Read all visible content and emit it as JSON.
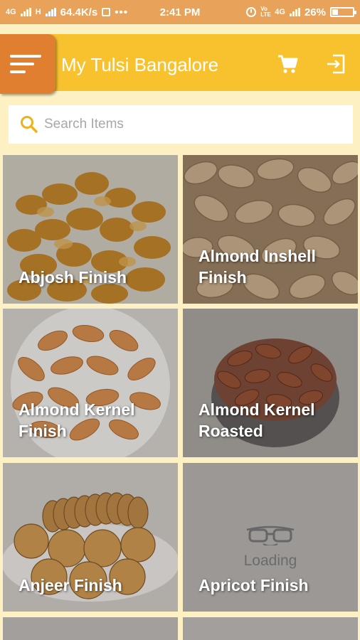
{
  "status_bar": {
    "network_left": "4G",
    "network_h": "H",
    "speed": "64.4K/s",
    "dots": "•••",
    "time": "2:41 PM",
    "volte": "Vo LTE",
    "network_right": "4G",
    "battery": "26%"
  },
  "app_bar": {
    "title": "My Tulsi Bangalore",
    "menu_icon": "hamburger-menu-icon",
    "cart_icon": "cart-icon",
    "exit_icon": "exit-icon",
    "color": "#f8c12e",
    "menu_color": "#e07f2f"
  },
  "search": {
    "placeholder": "Search Items",
    "icon": "search-icon"
  },
  "products": [
    {
      "label": "Abjosh Finish"
    },
    {
      "label": "Almond Inshell Finish"
    },
    {
      "label": "Almond Kernel Finish"
    },
    {
      "label": "Almond Kernel Roasted"
    },
    {
      "label": "Anjeer Finish"
    },
    {
      "label": "Apricot Finish",
      "loading_text": "Loading"
    }
  ]
}
